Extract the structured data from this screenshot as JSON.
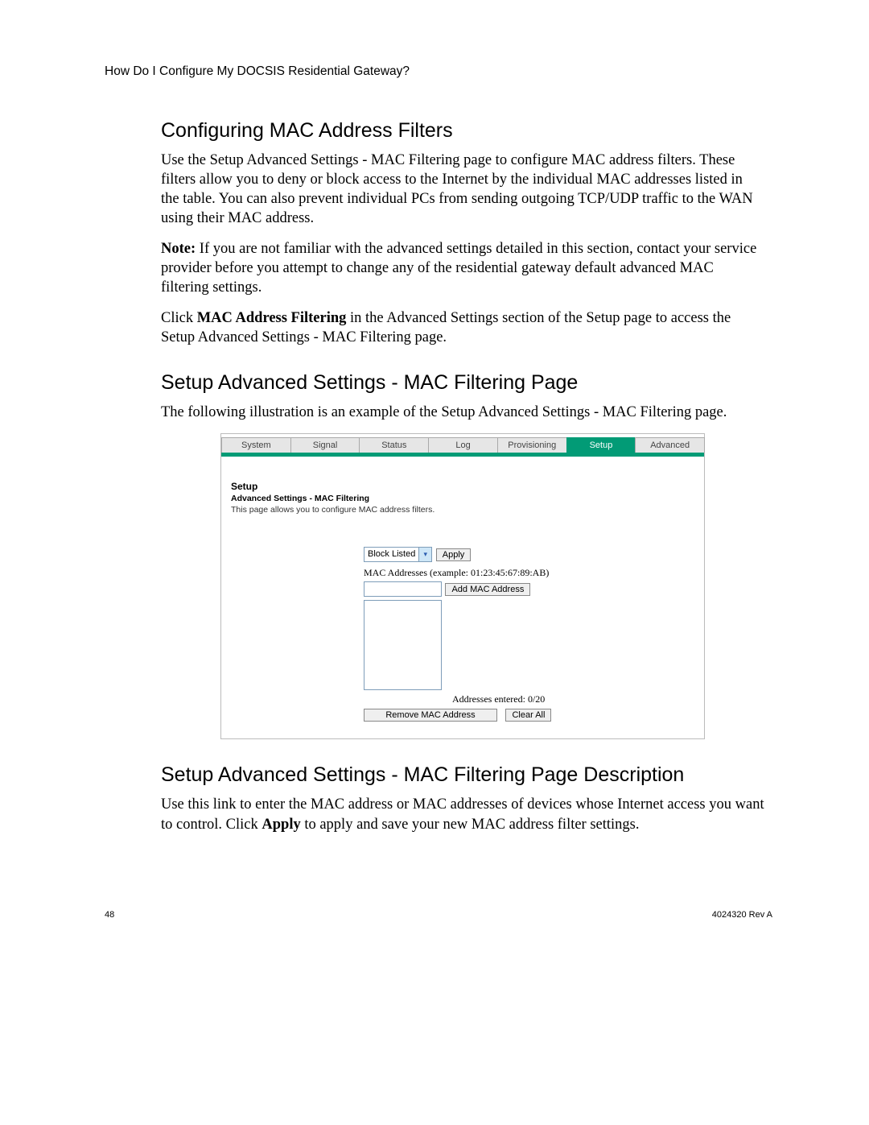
{
  "header": {
    "title": "How Do I Configure My DOCSIS Residential Gateway?"
  },
  "sections": {
    "s1": {
      "heading": "Configuring MAC Address Filters",
      "p1": "Use the Setup Advanced Settings - MAC Filtering page to configure MAC address filters. These filters allow you to deny or block access to the Internet by the individual MAC addresses listed in the table. You can also prevent individual PCs from sending outgoing TCP/UDP traffic to the WAN using their MAC address.",
      "noteLabel": "Note:",
      "p2": " If you are not familiar with the advanced settings detailed in this section, contact your service provider before you attempt to change any of the residential gateway default advanced MAC filtering settings.",
      "p3a": "Click ",
      "p3bold": "MAC Address Filtering",
      "p3b": " in the Advanced Settings section of the Setup page to access the Setup Advanced Settings - MAC Filtering page."
    },
    "s2": {
      "heading": "Setup Advanced Settings - MAC Filtering Page",
      "p1": "The following illustration is an example of the Setup Advanced Settings - MAC Filtering page."
    },
    "s3": {
      "heading": "Setup Advanced Settings - MAC Filtering Page Description",
      "p1a": "Use this link to enter the MAC address or MAC addresses of devices whose Internet access you want to control. Click ",
      "p1bold": "Apply",
      "p1b": " to apply and save your new MAC address filter settings."
    }
  },
  "screenshot": {
    "tabs": {
      "t0": "System",
      "t1": "Signal",
      "t2": "Status",
      "t3": "Log",
      "t4": "Provisioning",
      "t5": "Setup",
      "t6": "Advanced"
    },
    "title1": "Setup",
    "title2": "Advanced Settings - MAC Filtering",
    "desc": "This page allows you to configure MAC address filters.",
    "select": "Block Listed",
    "apply": "Apply",
    "macLabel": "MAC Addresses (example: 01:23:45:67:89:AB)",
    "addBtn": "Add MAC Address",
    "entered": "Addresses entered: 0/20",
    "removeBtn": "Remove MAC Address",
    "clearBtn": "Clear All"
  },
  "footer": {
    "page": "48",
    "doc": "4024320 Rev A"
  }
}
